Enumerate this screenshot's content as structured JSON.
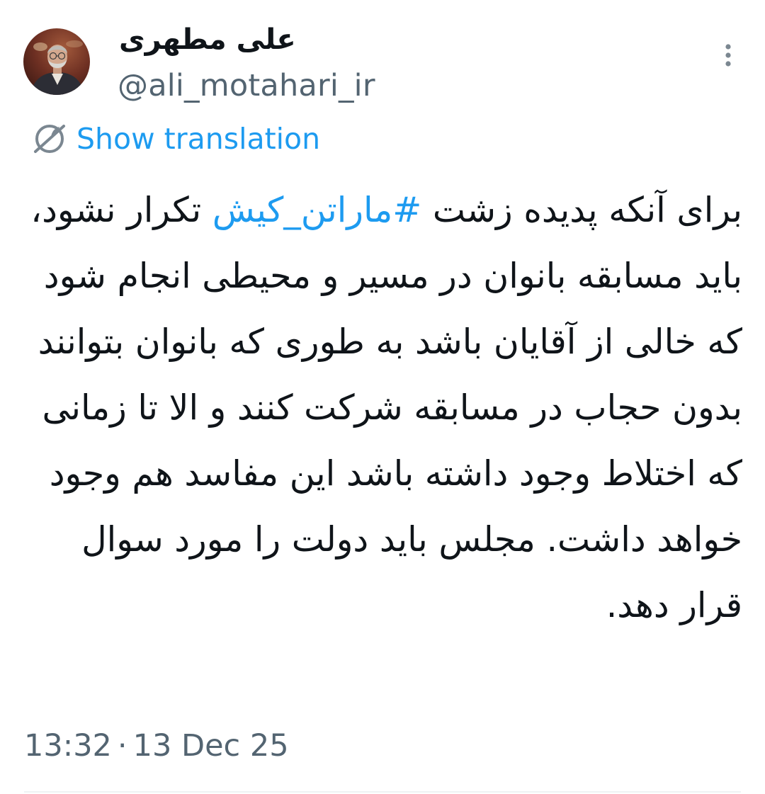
{
  "author": {
    "display_name": "علی مطهری",
    "handle": "@ali_motahari_ir"
  },
  "actions": {
    "more_icon": "more-vertical-icon"
  },
  "translation": {
    "icon": "globe-translate-icon",
    "label": "Show translation"
  },
  "tweet": {
    "text_before_hashtag": "برای آنکه پدیده زشت ",
    "hashtag": "#ماراتن_کیش",
    "text_after_hashtag": " تکرار نشود، باید مسابقه بانوان در مسیر و محیطی انجام شود که خالی از آقایان باشد به طوری که بانوان بتوانند بدون حجاب در مسابقه شرکت کنند و الا تا زمانی که اختلاط وجود داشته باشد این مفاسد هم وجود خواهد داشت. مجلس باید دولت را مورد سوال قرار دهد."
  },
  "meta": {
    "time": "13:32",
    "separator": "·",
    "date": "13 Dec 25"
  },
  "colors": {
    "link": "#1d9bf0",
    "secondary_text": "#536471",
    "primary_text": "#0f1419",
    "divider": "#eff3f4"
  }
}
